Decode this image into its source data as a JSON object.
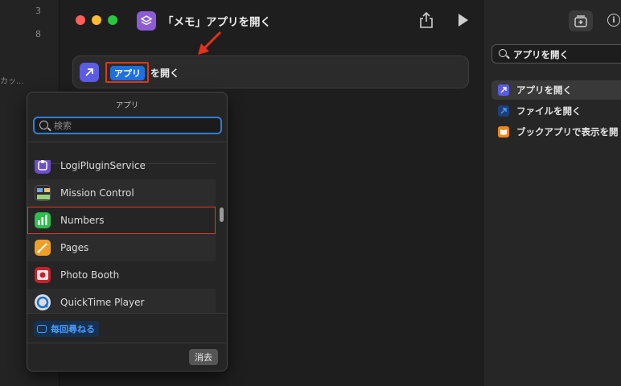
{
  "left_strip": {
    "line_numbers": [
      "3",
      "8"
    ],
    "snippet": "カッ..."
  },
  "window": {
    "title": "「メモ」アプリを開く"
  },
  "action": {
    "token_label": "アプリ",
    "suffix": "を開く"
  },
  "popover": {
    "title": "アプリ",
    "search_placeholder": "検索",
    "apps": [
      {
        "name": "LogiPluginService",
        "icon": "logi-plugin-icon"
      },
      {
        "name": "Mission Control",
        "icon": "mission-control-icon"
      },
      {
        "name": "Numbers",
        "icon": "numbers-icon"
      },
      {
        "name": "Pages",
        "icon": "pages-icon"
      },
      {
        "name": "Photo Booth",
        "icon": "photo-booth-icon"
      },
      {
        "name": "QuickTime Player",
        "icon": "quicktime-icon"
      }
    ],
    "ask_each_time": "毎回尋ねる",
    "clear": "消去"
  },
  "sidebar": {
    "search_query": "アプリを開く",
    "results": [
      {
        "label": "アプリを開く",
        "icon": "open-app-icon",
        "color": "#5b5ce2"
      },
      {
        "label": "ファイルを開く",
        "icon": "open-file-icon",
        "color": "#2a5cc7"
      },
      {
        "label": "ブックアプリで表示を開",
        "icon": "books-icon",
        "color": "#f0851c"
      }
    ]
  },
  "colors": {
    "accent": "#1e6fe0",
    "highlight_outline": "#d83a20",
    "numbers_green": "#2fbe4b",
    "pages_orange": "#f0a028"
  }
}
